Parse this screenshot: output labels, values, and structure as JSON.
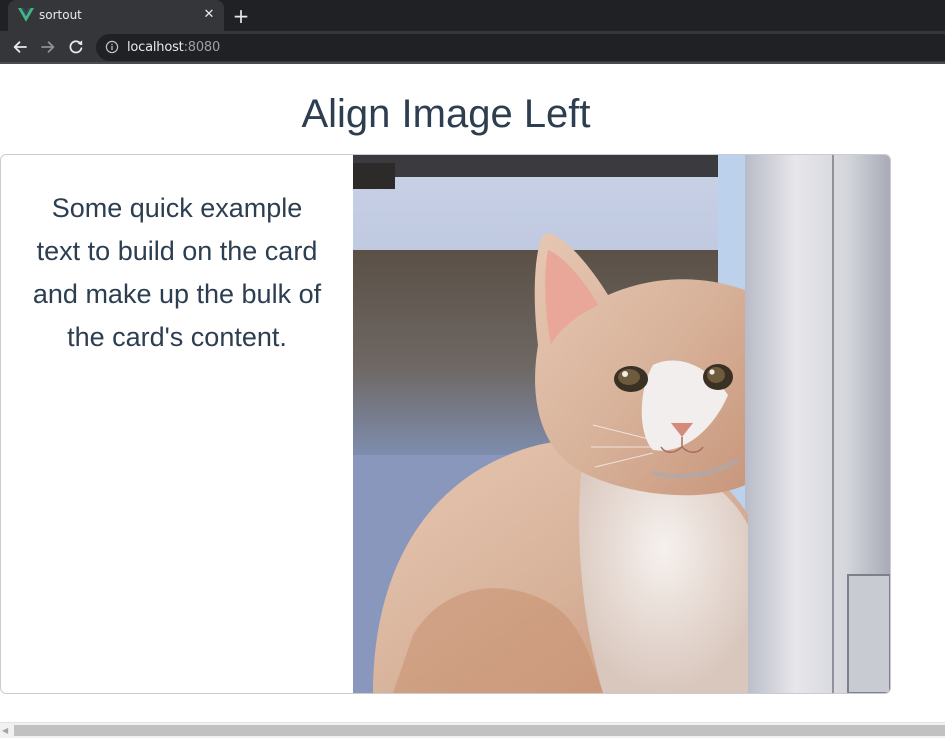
{
  "browser": {
    "tab": {
      "title": "sortout",
      "favicon": "vue-logo-icon",
      "close_glyph": "✕"
    },
    "new_tab_glyph": "+",
    "address": {
      "host": "localhost",
      "port": ":8080"
    },
    "colors": {
      "tabbar": "#202124",
      "toolbar": "#35363a",
      "vue_green": "#41b883",
      "vue_dark": "#35495e"
    }
  },
  "page": {
    "title": "Align Image Left",
    "card": {
      "text": "Some quick example text to build on the card and make up the bulk of the card's content.",
      "image": "orange-white-kitten-photo"
    },
    "colors": {
      "text": "#2c3e50",
      "border": "#c9cdd2"
    }
  }
}
